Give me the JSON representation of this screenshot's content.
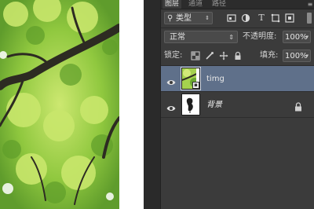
{
  "panel": {
    "tabs": [
      {
        "label": "图层",
        "active": true
      },
      {
        "label": "通道",
        "active": false
      },
      {
        "label": "路径",
        "active": false
      }
    ],
    "menu_icon": "panel-menu-icon"
  },
  "filter": {
    "kind_label": "类型",
    "icons": [
      "pixel-filter-icon",
      "adjustment-filter-icon",
      "type-filter-icon",
      "shape-filter-icon",
      "smart-object-filter-icon"
    ]
  },
  "blend": {
    "mode": "正常",
    "opacity_label": "不透明度:",
    "opacity_value": "100%"
  },
  "lock": {
    "label": "锁定:",
    "fill_label": "填充:",
    "fill_value": "100%",
    "icons": [
      "lock-transparent-icon",
      "lock-image-icon",
      "lock-position-icon",
      "lock-all-icon"
    ]
  },
  "layers": [
    {
      "name": "timg",
      "selected": true,
      "visible": true,
      "smart_object": true,
      "locked": false
    },
    {
      "name": "背景",
      "selected": false,
      "visible": true,
      "smart_object": false,
      "locked": true
    }
  ],
  "colors": {
    "panel_bg": "#3b3b3b",
    "selected_layer": "#5f708a",
    "canvas_bg": "#ffffff"
  }
}
